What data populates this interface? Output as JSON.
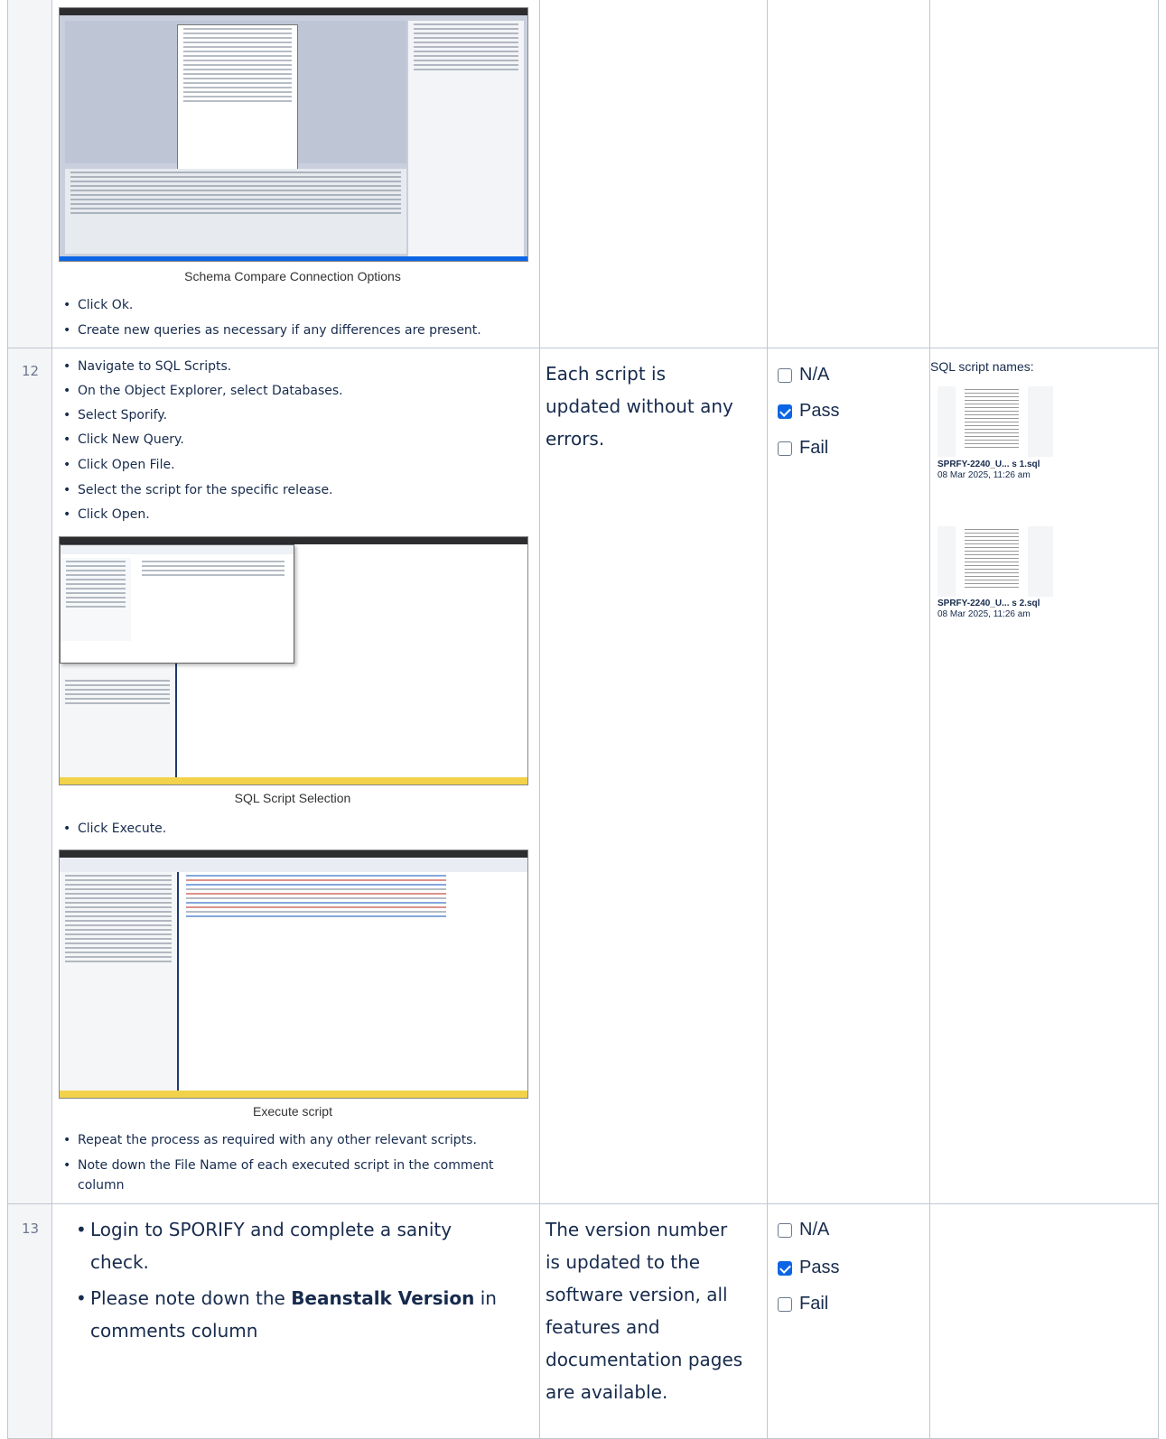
{
  "row_top": {
    "caption": "Schema Compare Connection Options",
    "steps": [
      "Click Ok.",
      "Create new queries as necessary if any differences are present."
    ]
  },
  "row12": {
    "number": "12",
    "steps_a": [
      "Navigate to SQL Scripts.",
      "On the Object Explorer, select Databases.",
      "Select Sporify.",
      "Click New Query.",
      "Click Open File.",
      "Select the script for the specific release.",
      "Click Open."
    ],
    "caption_a": "SQL Script Selection",
    "steps_b": [
      "Click Execute."
    ],
    "caption_b": "Execute script",
    "steps_c": [
      "Repeat the process as required with any other relevant scripts.",
      "Note down the File Name of each executed script in the comment",
      "column"
    ],
    "expected": [
      "Each script is",
      "updated without any",
      "errors."
    ],
    "options": [
      {
        "label": "N/A",
        "checked": false
      },
      {
        "label": "Pass",
        "checked": true
      },
      {
        "label": "Fail",
        "checked": false
      }
    ],
    "comment_title": "SQL script names:",
    "files": [
      {
        "name": "SPRFY-2240_U... s 1.sql",
        "date": "08 Mar 2025, 11:26 am"
      },
      {
        "name": "SPRFY-2240_U... s 2.sql",
        "date": "08 Mar 2025, 11:26 am"
      }
    ]
  },
  "row13": {
    "number": "13",
    "step1_a": "Login to SPORIFY and complete a sanity",
    "step1_b": "check.",
    "step2_a": "Please note down the ",
    "step2_bold": "Beanstalk Version",
    "step2_c": " in",
    "step2_d": "comments column",
    "expected": [
      "The version number",
      "is updated to the",
      "software version, all",
      "features and",
      "documentation pages",
      "are available."
    ],
    "options": [
      {
        "label": "N/A",
        "checked": false
      },
      {
        "label": "Pass",
        "checked": true
      },
      {
        "label": "Fail",
        "checked": false
      }
    ]
  }
}
